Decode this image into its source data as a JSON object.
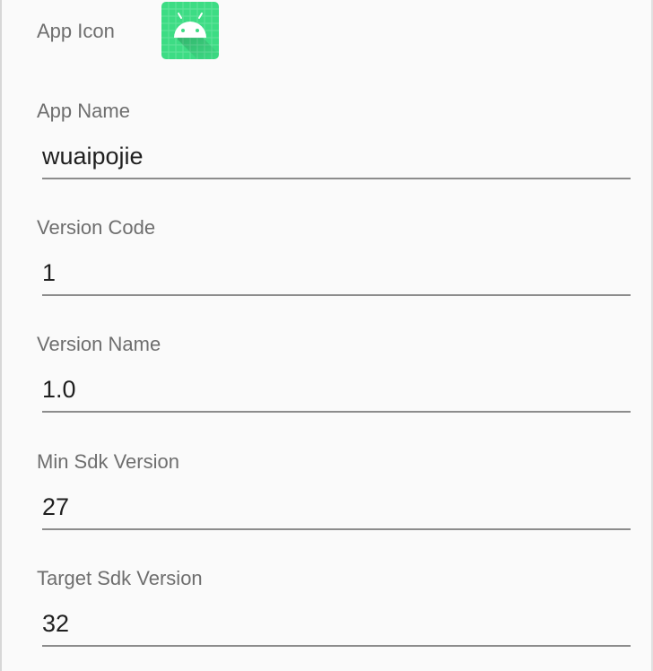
{
  "app_info": {
    "icon_label": "App Icon",
    "icon_name": "android-robot-icon",
    "icon_bg_color": "#3ddc84",
    "fields": [
      {
        "id": "app-name",
        "label": "App Name",
        "value": "wuaipojie"
      },
      {
        "id": "version-code",
        "label": "Version Code",
        "value": "1"
      },
      {
        "id": "version-name",
        "label": "Version Name",
        "value": "1.0"
      },
      {
        "id": "min-sdk-version",
        "label": "Min Sdk Version",
        "value": "27"
      },
      {
        "id": "target-sdk-version",
        "label": "Target Sdk Version",
        "value": "32"
      }
    ]
  }
}
